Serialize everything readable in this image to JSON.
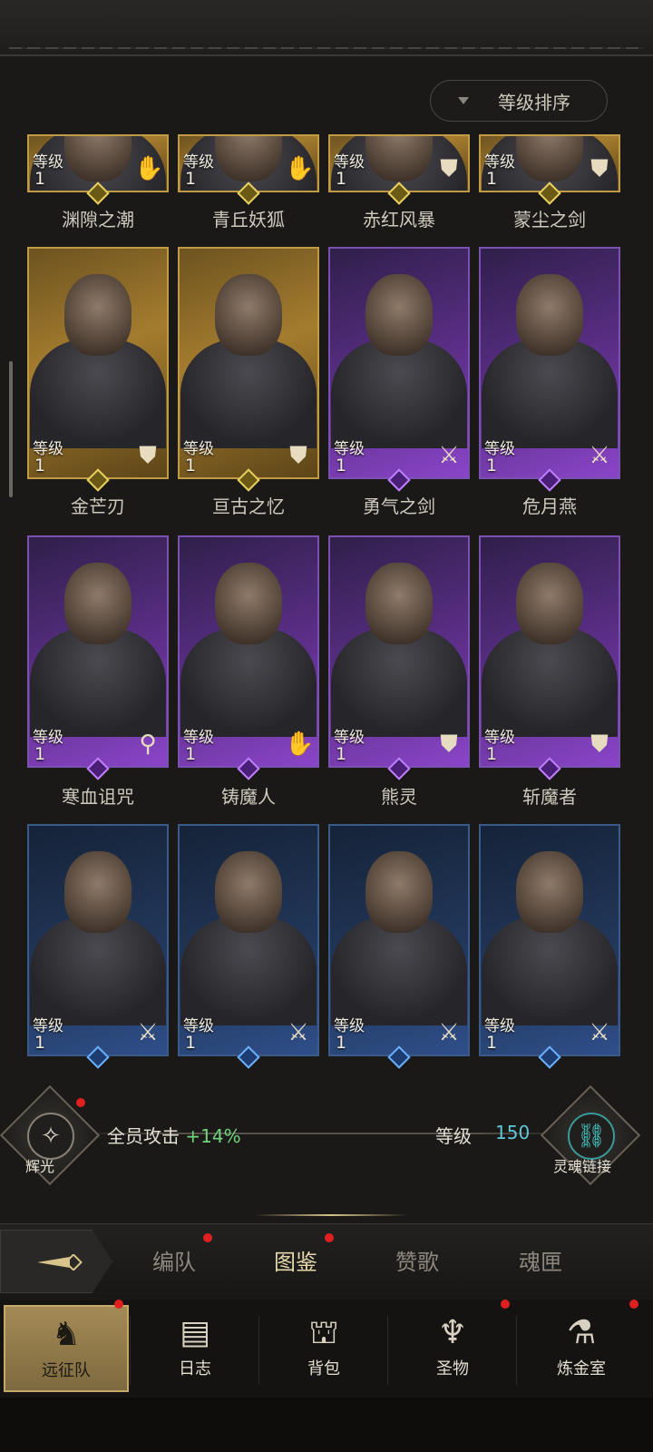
{
  "sort_button": {
    "label": "等级排序"
  },
  "level_label": "等级",
  "rows": [
    {
      "cards": [
        {
          "name": "渊隙之潮",
          "level": "1",
          "rarity": "gold",
          "class_icon": "palm-icon"
        },
        {
          "name": "青丘妖狐",
          "level": "1",
          "rarity": "gold",
          "class_icon": "palm-icon"
        },
        {
          "name": "赤红风暴",
          "level": "1",
          "rarity": "gold",
          "class_icon": "shield-icon"
        },
        {
          "name": "蒙尘之剑",
          "level": "1",
          "rarity": "gold",
          "class_icon": "shield-icon"
        }
      ]
    },
    {
      "cards": [
        {
          "name": "金芒刃",
          "level": "1",
          "rarity": "gold",
          "class_icon": "shield-icon"
        },
        {
          "name": "亘古之忆",
          "level": "1",
          "rarity": "gold",
          "class_icon": "shield-icon"
        },
        {
          "name": "勇气之剑",
          "level": "1",
          "rarity": "purple",
          "class_icon": "sword-icon"
        },
        {
          "name": "危月燕",
          "level": "1",
          "rarity": "purple",
          "class_icon": "sword-icon"
        }
      ]
    },
    {
      "cards": [
        {
          "name": "寒血诅咒",
          "level": "1",
          "rarity": "purple",
          "class_icon": "staff-icon"
        },
        {
          "name": "铸魔人",
          "level": "1",
          "rarity": "purple",
          "class_icon": "palm-icon"
        },
        {
          "name": "熊灵",
          "level": "1",
          "rarity": "purple",
          "class_icon": "shield-icon"
        },
        {
          "name": "斩魔者",
          "level": "1",
          "rarity": "purple",
          "class_icon": "shield-icon"
        }
      ]
    },
    {
      "cards": [
        {
          "name": "",
          "level": "1",
          "rarity": "blue",
          "class_icon": "sword-icon"
        },
        {
          "name": "",
          "level": "1",
          "rarity": "blue",
          "class_icon": "sword-icon"
        },
        {
          "name": "",
          "level": "1",
          "rarity": "blue",
          "class_icon": "sword-icon"
        },
        {
          "name": "",
          "level": "1",
          "rarity": "blue",
          "class_icon": "sword-icon"
        }
      ]
    }
  ],
  "bonus": {
    "left_emblem_label": "辉光",
    "text": "全员攻击",
    "value": "+14%",
    "level_label": "等级",
    "level_value": "150",
    "right_emblem_label": "灵魂链接"
  },
  "tabs": [
    {
      "label": "编队",
      "active": false,
      "badge": true
    },
    {
      "label": "图鉴",
      "active": true,
      "badge": true
    },
    {
      "label": "赞歌",
      "active": false,
      "badge": false
    },
    {
      "label": "魂匣",
      "active": false,
      "badge": false
    }
  ],
  "nav": [
    {
      "label": "远征队",
      "icon": "horned-helmet-icon",
      "active": true,
      "badge": true
    },
    {
      "label": "日志",
      "icon": "journal-icon",
      "active": false,
      "badge": false
    },
    {
      "label": "背包",
      "icon": "backpack-icon",
      "active": false,
      "badge": false
    },
    {
      "label": "圣物",
      "icon": "chalice-icon",
      "active": false,
      "badge": true
    },
    {
      "label": "炼金室",
      "icon": "alchemy-icon",
      "active": false,
      "badge": true
    }
  ],
  "colors": {
    "gold": "#a47c2e",
    "purple": "#5d2f8a",
    "blue": "#22385c",
    "bonus_green": "#6ed47a",
    "level_teal": "#5cc8d8",
    "badge_red": "#e02020"
  }
}
